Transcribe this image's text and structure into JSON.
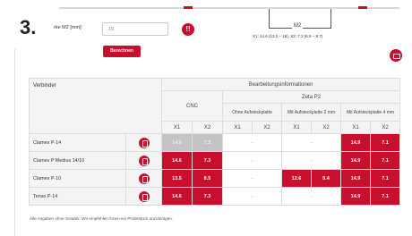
{
  "step_number": "3.",
  "form": {
    "width_label": "rke M2 [mm]:",
    "width_value": "19",
    "info_icon": "!!",
    "calculate_label": "Berechnen"
  },
  "diagram": {
    "label": "M2",
    "formula": "X1: 14.6 (13.2 – 16), X2: 7.3 (6.9 – 8.7)"
  },
  "colors": {
    "accent": "#c8102e",
    "disabled": "#c4c4c4",
    "header_bg": "#f4f4f4"
  },
  "table": {
    "connector_header": "Verbinder",
    "processing_header": "Bearbeitungsinformationen",
    "cnc_header": "CNC",
    "zeta_header": "Zeta P2",
    "sub_headers": [
      "Ohne Aufsteckplatte",
      "Mit Aufsteckplatte 2 mm",
      "Mit Aufsteckplatte 4 mm"
    ],
    "x_labels": [
      "X1",
      "X2",
      "X1",
      "X2",
      "X1",
      "X2",
      "X1",
      "X2"
    ],
    "rows": [
      {
        "name": "Clamex P-14",
        "cnc": [
          "14.6",
          "7.3"
        ],
        "cnc_state": "off",
        "ohne": "-",
        "mit2": "-",
        "mit4": [
          "14.9",
          "7.1"
        ]
      },
      {
        "name": "Clamex P Medius 14/10",
        "cnc": [
          "14.6",
          "7.3"
        ],
        "cnc_state": "on",
        "ohne": "-",
        "mit2": "-",
        "mit4": [
          "14.9",
          "7.1"
        ]
      },
      {
        "name": "Clamex P-10",
        "cnc": [
          "13.5",
          "8.5"
        ],
        "cnc_state": "on",
        "ohne": "-",
        "mit2": [
          "12.6",
          "9.4"
        ],
        "mit4": [
          "14.9",
          "7.1"
        ]
      },
      {
        "name": "Tenso P-14",
        "cnc": [
          "14.6",
          "7.3"
        ],
        "cnc_state": "on",
        "ohne": "-",
        "mit2": "-",
        "mit4": [
          "14.9",
          "7.1"
        ]
      }
    ]
  },
  "footnote": "Alle Angaben ohne Gewähr. Wir empfehlen Ihnen ein Probestück anzufertigen."
}
